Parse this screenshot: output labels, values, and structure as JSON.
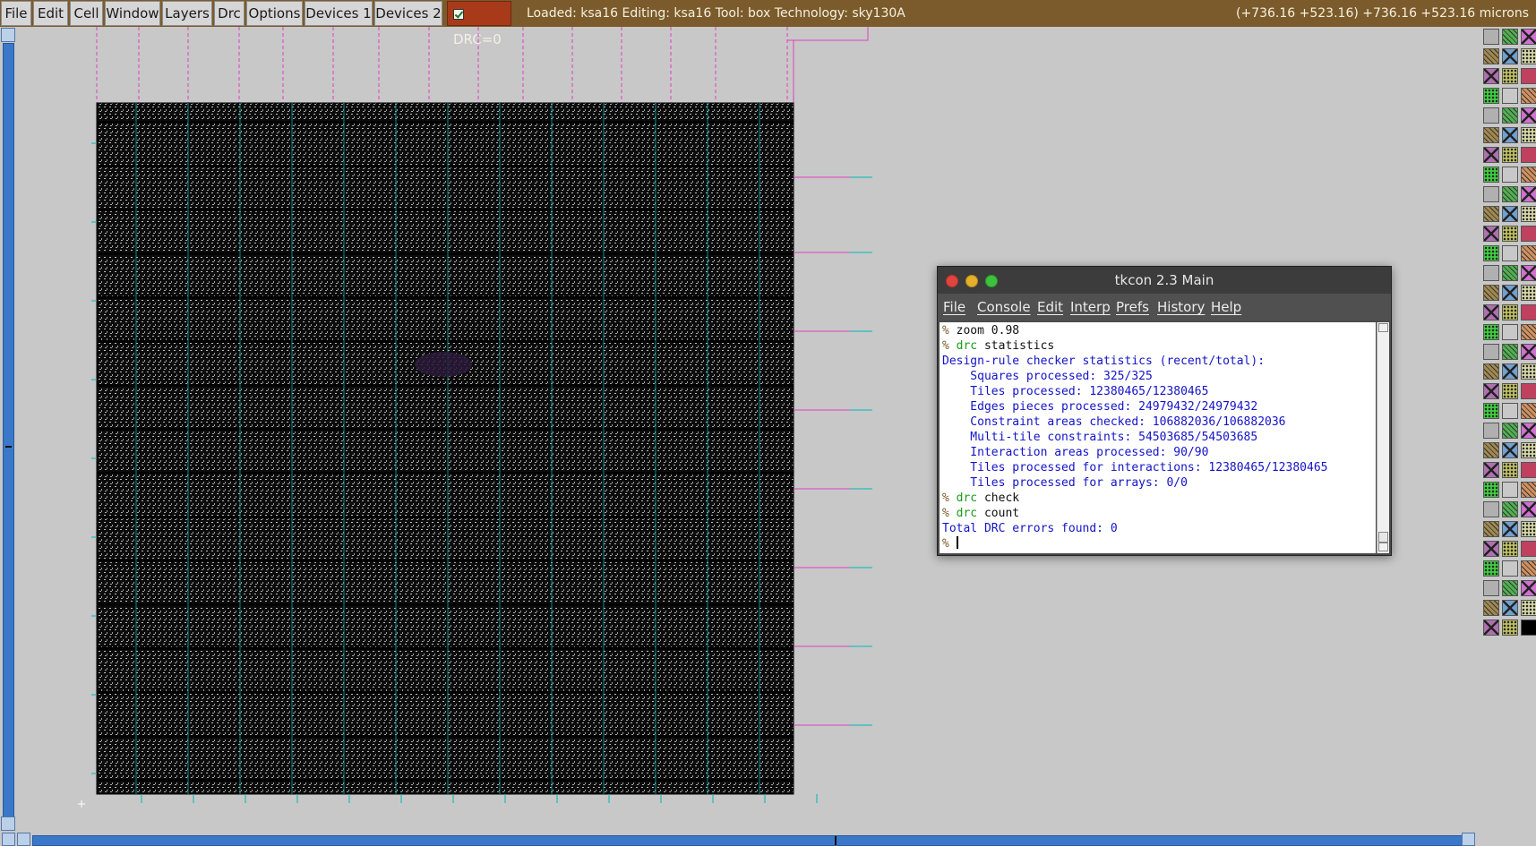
{
  "menubar": {
    "items": [
      "File",
      "Edit",
      "Cell",
      "Window",
      "Layers",
      "Drc",
      "Options",
      "Devices 1",
      "Devices 2"
    ],
    "drc_label": "DRC=0",
    "status": "Loaded: ksa16 Editing: ksa16 Tool: box  Technology: sky130A",
    "coordinates": "(+736.16 +523.16) +736.16 +523.16 microns"
  },
  "tkcon": {
    "title": "tkcon 2.3 Main",
    "menus": [
      "File",
      "Console",
      "Edit",
      "Interp",
      "Prefs",
      "History",
      "Help"
    ],
    "lines": [
      {
        "type": "cmd",
        "prompt": "% ",
        "kw": "",
        "text": "zoom 0.98"
      },
      {
        "type": "cmd",
        "prompt": "% ",
        "kw": "drc",
        "text": " statistics"
      },
      {
        "type": "out",
        "text": "Design-rule checker statistics (recent/total):"
      },
      {
        "type": "out",
        "text": "    Squares processed: 325/325"
      },
      {
        "type": "out",
        "text": "    Tiles processed: 12380465/12380465"
      },
      {
        "type": "out",
        "text": "    Edges pieces processed: 24979432/24979432"
      },
      {
        "type": "out",
        "text": "    Constraint areas checked: 106882036/106882036"
      },
      {
        "type": "out",
        "text": "    Multi-tile constraints: 54503685/54503685"
      },
      {
        "type": "out",
        "text": "    Interaction areas processed: 90/90"
      },
      {
        "type": "out",
        "text": "    Tiles processed for interactions: 12380465/12380465"
      },
      {
        "type": "out",
        "text": "    Tiles processed for arrays: 0/0"
      },
      {
        "type": "cmd",
        "prompt": "% ",
        "kw": "drc",
        "text": " check"
      },
      {
        "type": "cmd",
        "prompt": "% ",
        "kw": "drc",
        "text": " count"
      },
      {
        "type": "out",
        "text": "Total DRC errors found: 0"
      },
      {
        "type": "prompt",
        "prompt": "% "
      }
    ]
  },
  "colors": {
    "toolbar": "#7b5b2b",
    "drc_ok": "#a83a1a",
    "canvas_bg": "#c8c8c8",
    "cyan_lines": "#00b8b8",
    "magenta_lines": "#e040c0"
  }
}
